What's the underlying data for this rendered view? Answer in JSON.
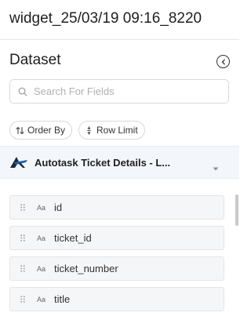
{
  "header": {
    "title": "widget_25/03/19 09:16_8220"
  },
  "dataset_panel": {
    "title": "Dataset",
    "search": {
      "placeholder": "Search For Fields",
      "value": ""
    },
    "order_by_label": "Order By",
    "row_limit_label": "Row Limit",
    "dataset_name": "Autotask Ticket Details - L...",
    "fields": [
      {
        "type": "Aa",
        "name": "id"
      },
      {
        "type": "Aa",
        "name": "ticket_id"
      },
      {
        "type": "Aa",
        "name": "ticket_number"
      },
      {
        "type": "Aa",
        "name": "title"
      }
    ]
  }
}
